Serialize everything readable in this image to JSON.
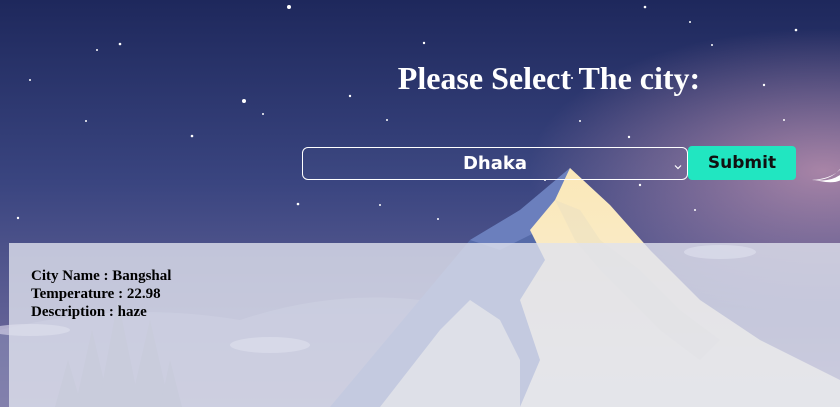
{
  "page": {
    "title": "Please Select The city:"
  },
  "form": {
    "selected_city": "Dhaka",
    "submit_label": "Submit"
  },
  "result": {
    "city_line": "City Name : Bangshal",
    "temperature_line": "Temperature : 22.98",
    "description_line": "Description : haze"
  },
  "colors": {
    "sky_top": "#1f2a5e",
    "sky_bottom": "#5d5f95",
    "accent": "#21e6c1",
    "mountain": "#f6f0dc",
    "moon": "#ffffff"
  },
  "icons": {
    "select_chevron": "chevron-down-icon"
  }
}
